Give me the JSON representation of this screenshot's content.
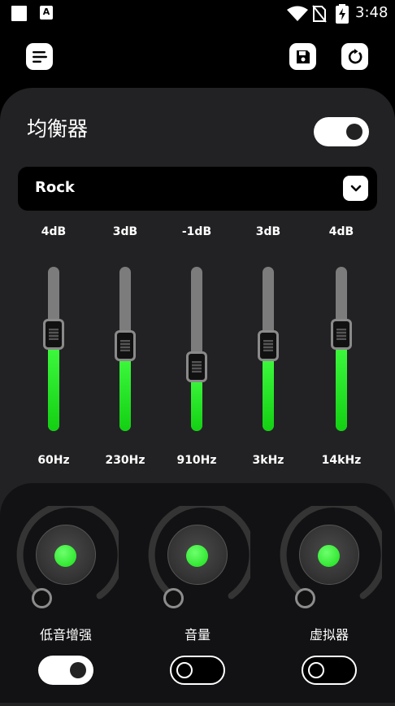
{
  "status_bar": {
    "time": "3:48",
    "icons": [
      "square-notification-icon",
      "a-notification-icon",
      "wifi-icon",
      "no-sim-icon",
      "battery-charging-icon"
    ]
  },
  "toolbar": {
    "icons": [
      "menu-icon",
      "save-icon",
      "reset-icon"
    ]
  },
  "equalizer": {
    "title": "均衡器",
    "enabled": true,
    "preset": "Rock",
    "bands": [
      {
        "gain": "4dB",
        "freq": "60Hz",
        "level": 0.59
      },
      {
        "gain": "3dB",
        "freq": "230Hz",
        "level": 0.52
      },
      {
        "gain": "-1dB",
        "freq": "910Hz",
        "level": 0.39
      },
      {
        "gain": "3dB",
        "freq": "3kHz",
        "level": 0.52
      },
      {
        "gain": "4dB",
        "freq": "14kHz",
        "level": 0.59
      }
    ]
  },
  "effects": [
    {
      "label": "低音增强",
      "enabled": true
    },
    {
      "label": "音量",
      "enabled": false
    },
    {
      "label": "虚拟器",
      "enabled": false
    }
  ],
  "colors": {
    "accent_green": "#19dd19",
    "panel": "#222224",
    "knob_panel": "#121214"
  }
}
